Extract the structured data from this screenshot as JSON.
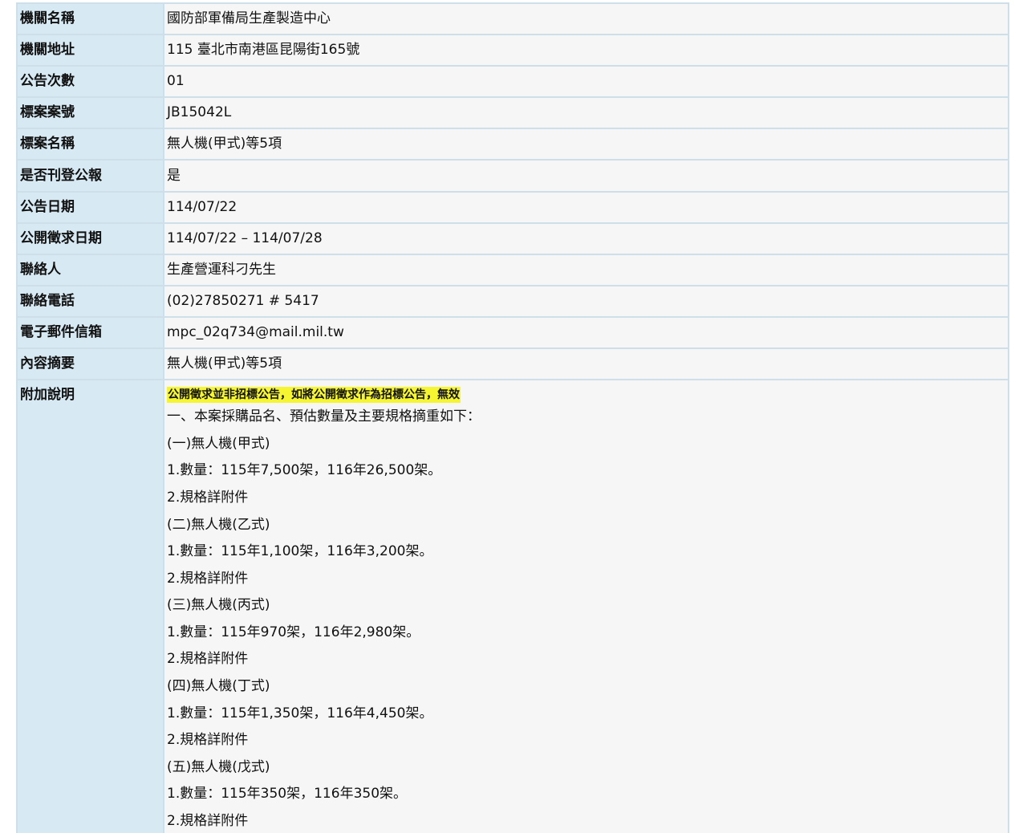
{
  "table": {
    "rows": [
      {
        "label": "機關名稱",
        "value": "國防部軍備局生產製造中心"
      },
      {
        "label": "機關地址",
        "value": "115 臺北市南港區昆陽街165號"
      },
      {
        "label": "公告次數",
        "value": "01"
      },
      {
        "label": "標案案號",
        "value": "JB15042L"
      },
      {
        "label": "標案名稱",
        "value": "無人機(甲式)等5項"
      },
      {
        "label": "是否刊登公報",
        "value": "是"
      },
      {
        "label": "公告日期",
        "value": "114/07/22"
      },
      {
        "label": "公開徵求日期",
        "value": "114/07/22 – 114/07/28"
      },
      {
        "label": "聯絡人",
        "value": "生產營運科刁先生"
      },
      {
        "label": "聯絡電話",
        "value": "(02)27850271 # 5417"
      },
      {
        "label": "電子郵件信箱",
        "value": "mpc_02q734@mail.mil.tw"
      },
      {
        "label": "內容摘要",
        "value": "無人機(甲式)等5項"
      }
    ],
    "notes": {
      "label": "附加說明",
      "highlight": "公開徵求並非招標公告，如將公開徵求作為招標公告，無效",
      "lines": [
        "一、本案採購品名、預估數量及主要規格摘重如下：",
        "(一)無人機(甲式)",
        "1.數量：115年7,500架，116年26,500架。",
        "2.規格詳附件",
        "(二)無人機(乙式)",
        "1.數量：115年1,100架，116年3,200架。",
        "2.規格詳附件",
        "(三)無人機(丙式)",
        "1.數量：115年970架，116年2,980架。",
        "2.規格詳附件",
        "(四)無人機(丁式)",
        "1.數量：115年1,350架，116年4,450架。",
        "2.規格詳附件",
        "(五)無人機(戊式)",
        "1.數量：115年350架，116年350架。",
        "2.規格詳附件"
      ]
    }
  },
  "colors": {
    "label_bg": "#d7e9f3",
    "value_bg": "#f6f6f6",
    "border": "#cfdfe9",
    "highlight": "#f5f531"
  }
}
